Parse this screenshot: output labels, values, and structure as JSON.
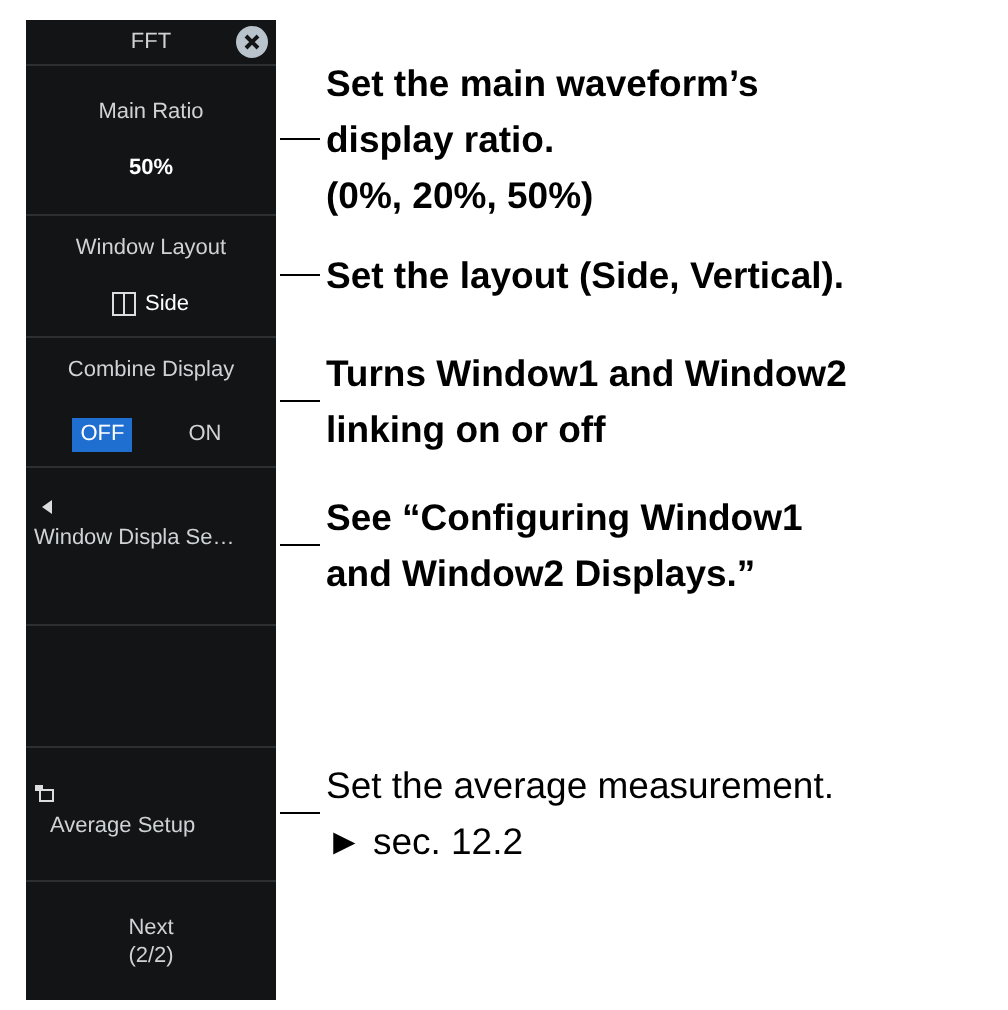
{
  "panel": {
    "title": "FFT",
    "items": [
      {
        "kind": "value",
        "label": "Main Ratio",
        "value": "50%",
        "note": {
          "text": "Set the main waveform’s\ndisplay ratio.\n(0%, 20%, 50%)",
          "bold": true
        }
      },
      {
        "kind": "layout",
        "label": "Window Layout",
        "value": "Side",
        "note": {
          "text": "Set the layout (Side, Vertical).",
          "bold": true
        }
      },
      {
        "kind": "toggle",
        "label": "Combine Display",
        "options": [
          {
            "label": "OFF",
            "selected": true
          },
          {
            "label": "ON",
            "selected": false
          }
        ],
        "note": {
          "text": "Turns Window1 and Window2\nlinking on or off",
          "bold": true
        }
      },
      {
        "kind": "submenu",
        "label": "Window Displa Se…",
        "note": {
          "text": "See “Configuring Window1\nand Window2 Displays.”",
          "bold": true
        }
      },
      {
        "kind": "empty"
      },
      {
        "kind": "dialog",
        "label": "Average Setup",
        "note": {
          "text": "Set the average measurement.",
          "ref": "► sec. 12.2",
          "bold": false
        }
      },
      {
        "kind": "next",
        "label": "Next",
        "page": "(2/2)"
      }
    ]
  }
}
